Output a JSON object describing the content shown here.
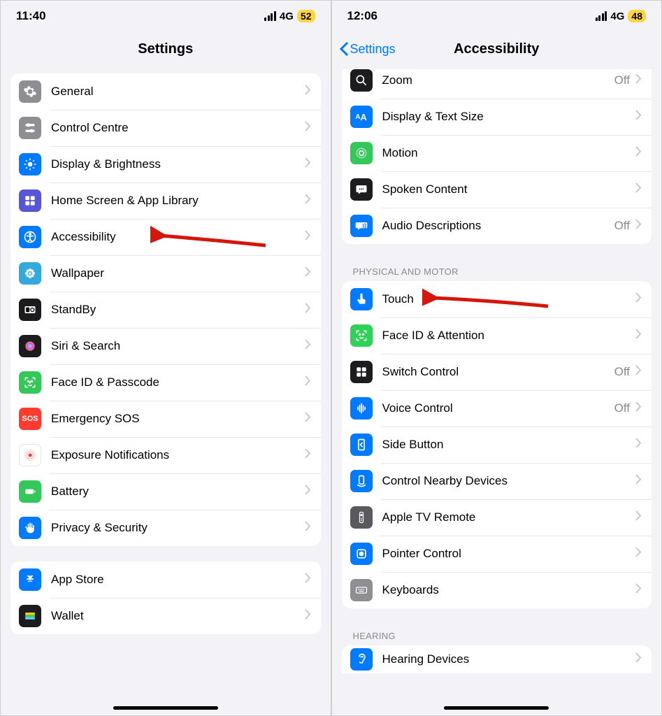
{
  "left": {
    "status": {
      "time": "11:40",
      "net": "4G",
      "battery": "52"
    },
    "nav": {
      "title": "Settings"
    },
    "group1": [
      {
        "label": "General"
      },
      {
        "label": "Control Centre"
      },
      {
        "label": "Display & Brightness"
      },
      {
        "label": "Home Screen & App Library"
      },
      {
        "label": "Accessibility"
      },
      {
        "label": "Wallpaper"
      },
      {
        "label": "StandBy"
      },
      {
        "label": "Siri & Search"
      },
      {
        "label": "Face ID & Passcode"
      },
      {
        "label": "Emergency SOS"
      },
      {
        "label": "Exposure Notifications"
      },
      {
        "label": "Battery"
      },
      {
        "label": "Privacy & Security"
      }
    ],
    "group2": [
      {
        "label": "App Store"
      },
      {
        "label": "Wallet"
      }
    ]
  },
  "right": {
    "status": {
      "time": "12:06",
      "net": "4G",
      "battery": "48"
    },
    "nav": {
      "back": "Settings",
      "title": "Accessibility"
    },
    "vision": [
      {
        "label": "Zoom",
        "value": "Off"
      },
      {
        "label": "Display & Text Size"
      },
      {
        "label": "Motion"
      },
      {
        "label": "Spoken Content"
      },
      {
        "label": "Audio Descriptions",
        "value": "Off"
      }
    ],
    "section_physical": "Physical and Motor",
    "physical": [
      {
        "label": "Touch"
      },
      {
        "label": "Face ID & Attention"
      },
      {
        "label": "Switch Control",
        "value": "Off"
      },
      {
        "label": "Voice Control",
        "value": "Off"
      },
      {
        "label": "Side Button"
      },
      {
        "label": "Control Nearby Devices"
      },
      {
        "label": "Apple TV Remote"
      },
      {
        "label": "Pointer Control"
      },
      {
        "label": "Keyboards"
      }
    ],
    "section_hearing": "Hearing",
    "hearing": [
      {
        "label": "Hearing Devices"
      }
    ]
  }
}
